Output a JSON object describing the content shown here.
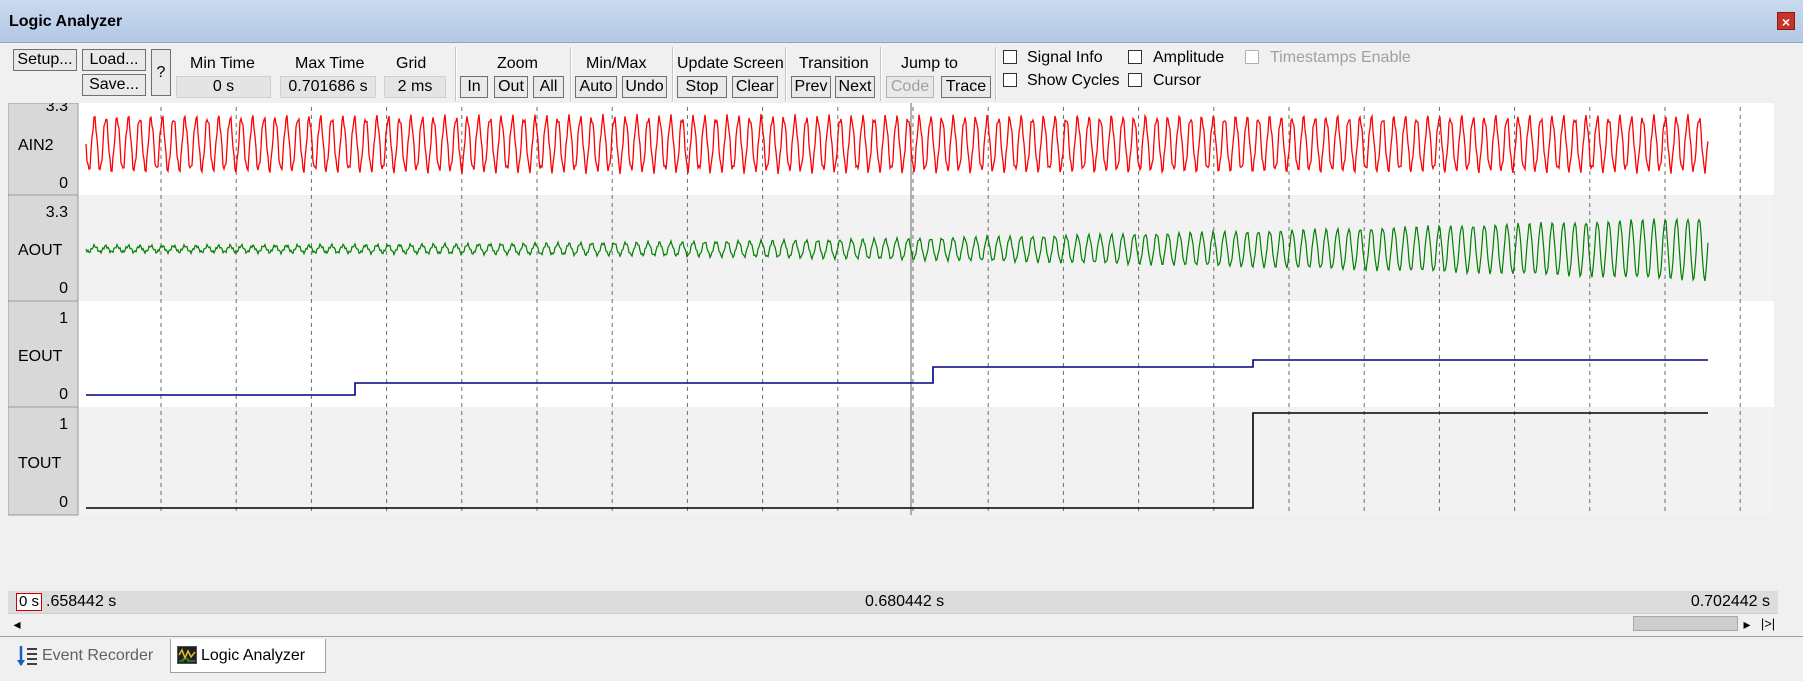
{
  "window": {
    "title": "Logic Analyzer",
    "close_glyph": "×"
  },
  "toolbar": {
    "setup_label": "Setup...",
    "load_label": "Load...",
    "save_label": "Save...",
    "help_label": "?",
    "min_time_label": "Min Time",
    "min_time_value": "0 s",
    "max_time_label": "Max Time",
    "max_time_value": "0.701686 s",
    "grid_label": "Grid",
    "grid_value": "2 ms",
    "zoom_label": "Zoom",
    "zoom_in": "In",
    "zoom_out": "Out",
    "zoom_all": "All",
    "minmax_label": "Min/Max",
    "minmax_auto": "Auto",
    "minmax_undo": "Undo",
    "update_label": "Update Screen",
    "update_stop": "Stop",
    "update_clear": "Clear",
    "transition_label": "Transition",
    "transition_prev": "Prev",
    "transition_next": "Next",
    "jump_label": "Jump to",
    "jump_code": "Code",
    "jump_trace": "Trace",
    "signal_info": "Signal Info",
    "show_cycles": "Show Cycles",
    "amplitude": "Amplitude",
    "cursor": "Cursor",
    "timestamps": "Timestamps Enable"
  },
  "signals": [
    {
      "name": "AIN2",
      "max": "3.3",
      "min": "0",
      "color": "#ff0000"
    },
    {
      "name": "AOUT",
      "max": "3.3",
      "min": "0",
      "color": "#008000"
    },
    {
      "name": "EOUT",
      "max": "1",
      "min": "0",
      "color": "#000080"
    },
    {
      "name": "TOUT",
      "max": "1",
      "min": "0",
      "color": "#000000"
    }
  ],
  "timeline": {
    "cursor_box": "0 s",
    "start": ".658442 s",
    "middle": "0.680442 s",
    "end": "0.702442 s"
  },
  "scroll": {
    "left_glyph": "◂",
    "right_glyph": "▸",
    "end_glyph": "|>|"
  },
  "tabs": [
    {
      "label": "Event Recorder",
      "icon": "event-recorder-icon",
      "active": false
    },
    {
      "label": "Logic Analyzer",
      "icon": "logic-analyzer-icon",
      "active": true
    }
  ]
}
